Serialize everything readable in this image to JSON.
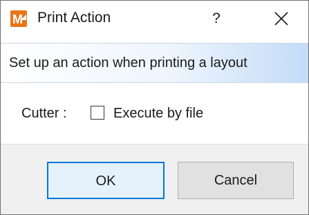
{
  "window": {
    "title": "Print Action",
    "help_glyph": "?",
    "app_icon_letter": "M",
    "accent_color": "#e8751a"
  },
  "banner": {
    "text": "Set up an action when printing a layout"
  },
  "options": {
    "cutter_label": "Cutter :",
    "execute_by_file_label": "Execute by file",
    "execute_by_file_checked": false
  },
  "footer": {
    "ok_label": "OK",
    "cancel_label": "Cancel"
  }
}
